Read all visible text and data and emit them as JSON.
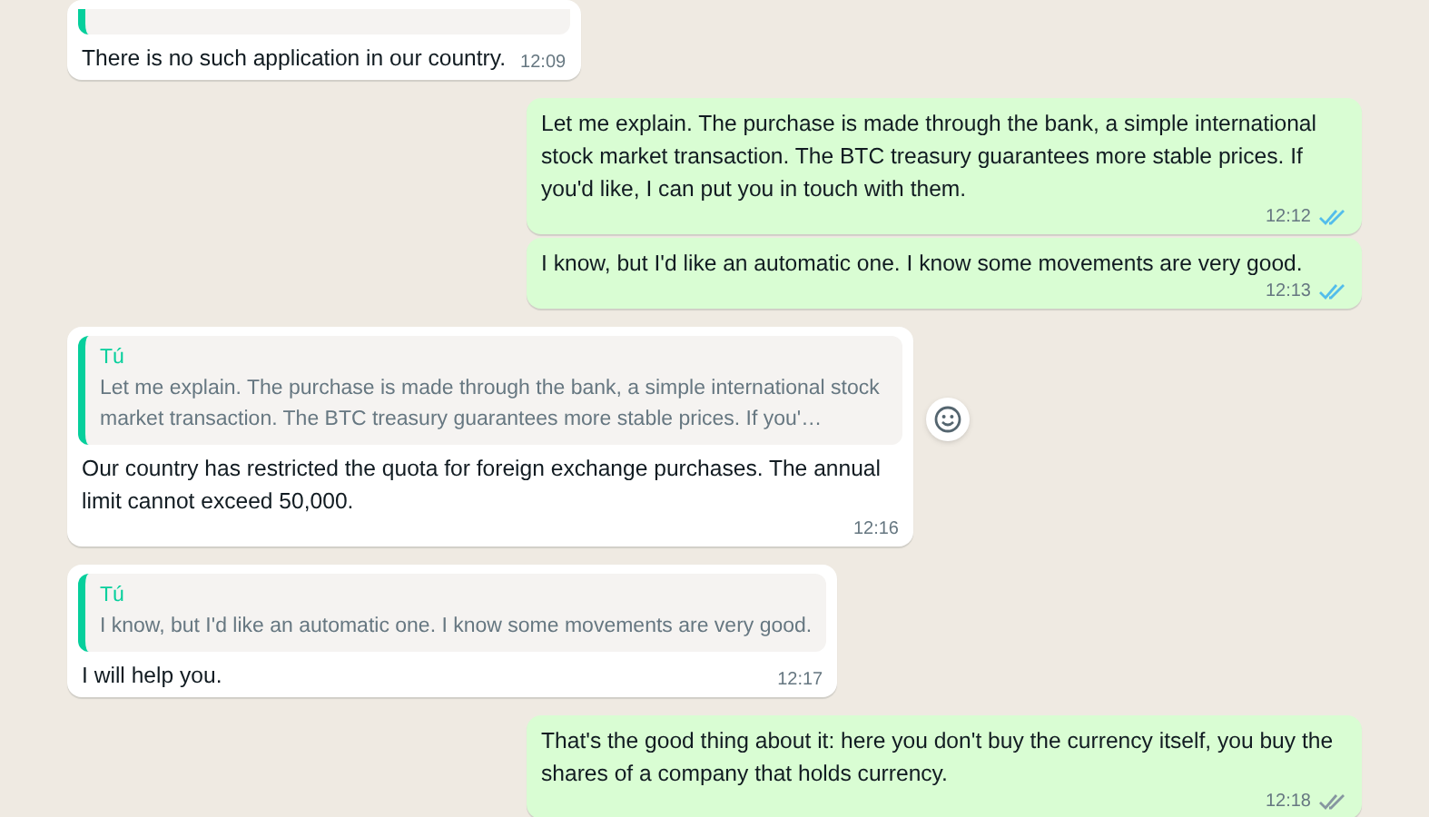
{
  "messages": [
    {
      "kind": "incoming",
      "quote_cut": true,
      "text": "There is no such application in our country.",
      "time": "12:09"
    },
    {
      "kind": "outgoing",
      "text": "Let me explain. The purchase is made through the bank, a simple international stock market transaction. The BTC treasury guarantees more stable prices. If you'd like, I can put you in touch with them.",
      "time": "12:12",
      "read": true
    },
    {
      "kind": "outgoing",
      "text": "I know, but I'd like an automatic one. I know some movements are very good.",
      "time": "12:13",
      "read": true
    },
    {
      "kind": "incoming",
      "quote": {
        "author": "Tú",
        "text": "Let me explain. The purchase is made through the bank, a simple international stock market transaction. The BTC treasury guarantees more stable prices. If you'…"
      },
      "text": "Our country has restricted the quota for foreign exchange purchases. The annual limit cannot exceed 50,000.",
      "time": "12:16",
      "react_button": true
    },
    {
      "kind": "incoming",
      "quote": {
        "author": "Tú",
        "text": "I know, but I'd like an automatic one. I know some movements are very good."
      },
      "text": "I will help you.",
      "time": "12:17"
    },
    {
      "kind": "outgoing",
      "text": "That's the good thing about it: here you don't buy the currency itself, you buy the shares of a company that holds currency.",
      "time": "12:18",
      "read": false
    }
  ]
}
